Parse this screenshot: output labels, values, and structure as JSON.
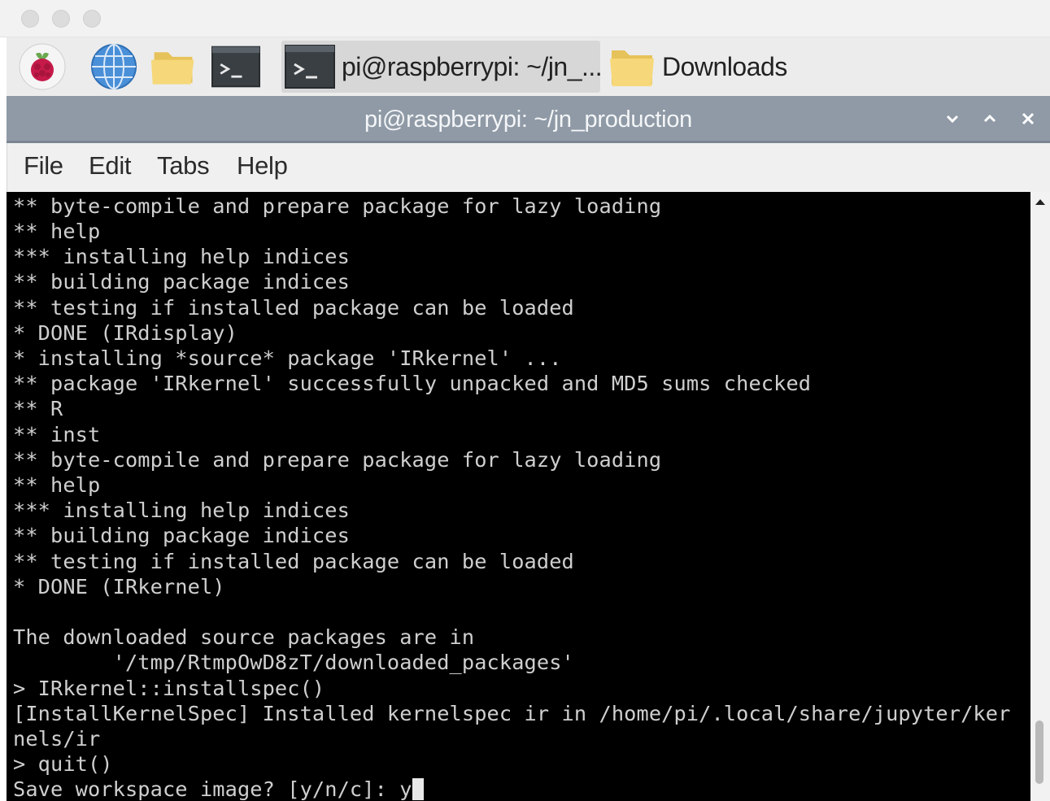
{
  "taskbar": {
    "terminal_task_label": "pi@raspberrypi: ~/jn_...",
    "downloads_task_label": "Downloads"
  },
  "window": {
    "title": "pi@raspberrypi: ~/jn_production"
  },
  "menu": {
    "file": "File",
    "edit": "Edit",
    "tabs": "Tabs",
    "help": "Help"
  },
  "terminal": {
    "lines": [
      "** byte-compile and prepare package for lazy loading",
      "** help",
      "*** installing help indices",
      "** building package indices",
      "** testing if installed package can be loaded",
      "* DONE (IRdisplay)",
      "* installing *source* package 'IRkernel' ...",
      "** package 'IRkernel' successfully unpacked and MD5 sums checked",
      "** R",
      "** inst",
      "** byte-compile and prepare package for lazy loading",
      "** help",
      "*** installing help indices",
      "** building package indices",
      "** testing if installed package can be loaded",
      "* DONE (IRkernel)",
      "",
      "The downloaded source packages are in",
      "        '/tmp/RtmpOwD8zT/downloaded_packages'",
      "> IRkernel::installspec()",
      "[InstallKernelSpec] Installed kernelspec ir in /home/pi/.local/share/jupyter/ker",
      "nels/ir",
      "> quit()"
    ],
    "prompt_text": "Save workspace image? [y/n/c]: y"
  },
  "colors": {
    "titlebar": "#8f9aa6",
    "terminal_bg": "#000000",
    "terminal_fg": "#cfcfcf"
  }
}
